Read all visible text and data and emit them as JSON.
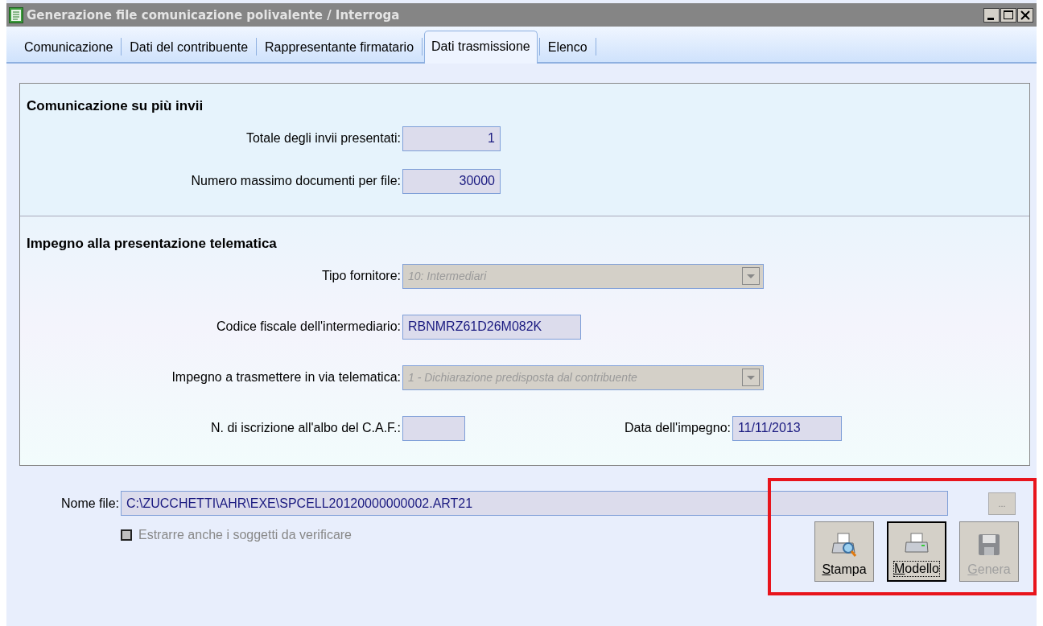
{
  "window": {
    "title": "Generazione file comunicazione polivalente / Interroga"
  },
  "tabs": [
    {
      "label": "Comunicazione",
      "selected": false
    },
    {
      "label": "Dati del contribuente",
      "selected": false
    },
    {
      "label": "Rappresentante firmatario",
      "selected": false
    },
    {
      "label": "Dati trasmissione",
      "selected": true
    },
    {
      "label": "Elenco",
      "selected": false
    }
  ],
  "sections": [
    {
      "title": "Comunicazione su più invii",
      "rows": [
        [
          {
            "label": "Totale degli invii presentati:",
            "value": "1",
            "kind": "number"
          }
        ],
        [
          {
            "label": "Numero massimo documenti per file:",
            "value": "30000",
            "kind": "number"
          }
        ]
      ]
    },
    {
      "title": "Impegno alla presentazione telematica",
      "rows": [
        [
          {
            "label": "Tipo fornitore:",
            "value": "10: Intermediari",
            "kind": "select"
          }
        ],
        [
          {
            "label": "Codice fiscale dell'intermediario:",
            "value": "RBNMRZ61D26M082K",
            "kind": "text"
          }
        ],
        [
          {
            "label": "Impegno a trasmettere in via telematica:",
            "value": "1 - Dichiarazione predisposta dal contribuente",
            "kind": "select"
          }
        ],
        [
          {
            "label": "N. di iscrizione all'albo del C.A.F.:",
            "kind": "short"
          },
          {
            "label": "Data dell'impegno:",
            "value": "11/11/2013",
            "kind": "date"
          }
        ]
      ]
    }
  ],
  "file": {
    "label": "Nome file:",
    "value": "C:\\ZUCCHETTI\\AHR\\EXE\\SPCELL20120000000002.ART21",
    "browse": "..."
  },
  "checkbox": {
    "label": "Estrarre anche i soggetti da verificare",
    "checked": false,
    "disabled": true
  },
  "buttons": [
    {
      "label": "Stampa",
      "kind": "preview",
      "disabled": false,
      "focused": false
    },
    {
      "label": "Modello",
      "kind": "print",
      "disabled": false,
      "focused": true
    },
    {
      "label": "Genera",
      "kind": "save",
      "disabled": true,
      "focused": false
    }
  ]
}
